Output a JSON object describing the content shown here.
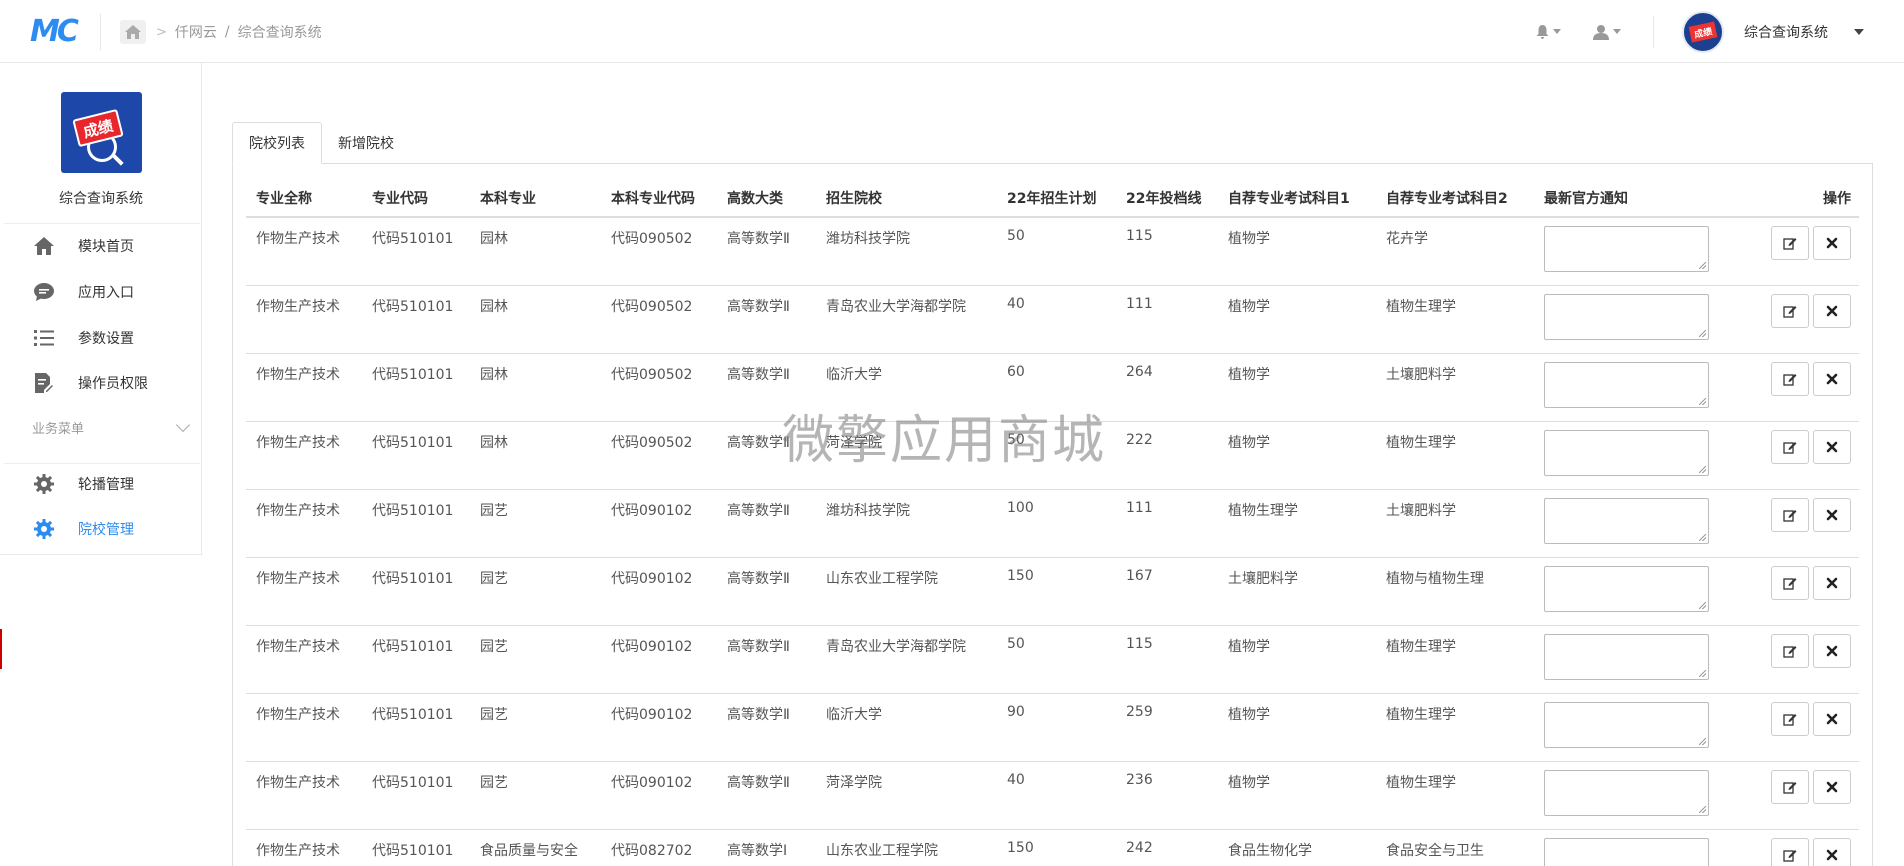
{
  "header": {
    "logo_text": "MC",
    "breadcrumb": [
      "仟网云",
      "综合查询系统"
    ],
    "breadcrumb_separator": "/",
    "user_name": "综合查询系统",
    "avatar_text": "成绩"
  },
  "sidebar": {
    "app_logo_text": "成绩",
    "app_name": "综合查询系统",
    "items": [
      {
        "label": "模块首页",
        "icon": "home-icon"
      },
      {
        "label": "应用入口",
        "icon": "chat-icon"
      },
      {
        "label": "参数设置",
        "icon": "list-icon"
      },
      {
        "label": "操作员权限",
        "icon": "document-edit-icon"
      }
    ],
    "section_title": "业务菜单",
    "section_items": [
      {
        "label": "轮播管理",
        "icon": "gear-icon"
      },
      {
        "label": "院校管理",
        "icon": "gear-icon",
        "active": true
      }
    ],
    "accent_color": "#2d8cf0"
  },
  "tabs": [
    {
      "label": "院校列表",
      "active": true
    },
    {
      "label": "新增院校",
      "active": false
    }
  ],
  "table": {
    "columns": [
      "专业全称",
      "专业代码",
      "本科专业",
      "本科专业代码",
      "高数大类",
      "招生院校",
      "22年招生计划",
      "22年投档线",
      "自荐专业考试科目1",
      "自荐专业考试科目2",
      "最新官方通知",
      "操作"
    ],
    "rows": [
      [
        "作物生产技术",
        "代码510101",
        "园林",
        "代码090502",
        "高等数学Ⅱ",
        "潍坊科技学院",
        "50",
        "115",
        "植物学",
        "花卉学"
      ],
      [
        "作物生产技术",
        "代码510101",
        "园林",
        "代码090502",
        "高等数学Ⅱ",
        "青岛农业大学海都学院",
        "40",
        "111",
        "植物学",
        "植物生理学"
      ],
      [
        "作物生产技术",
        "代码510101",
        "园林",
        "代码090502",
        "高等数学Ⅱ",
        "临沂大学",
        "60",
        "264",
        "植物学",
        "土壤肥料学"
      ],
      [
        "作物生产技术",
        "代码510101",
        "园林",
        "代码090502",
        "高等数学Ⅱ",
        "菏泽学院",
        "50",
        "222",
        "植物学",
        "植物生理学"
      ],
      [
        "作物生产技术",
        "代码510101",
        "园艺",
        "代码090102",
        "高等数学Ⅱ",
        "潍坊科技学院",
        "100",
        "111",
        "植物生理学",
        "土壤肥料学"
      ],
      [
        "作物生产技术",
        "代码510101",
        "园艺",
        "代码090102",
        "高等数学Ⅱ",
        "山东农业工程学院",
        "150",
        "167",
        "土壤肥料学",
        "植物与植物生理"
      ],
      [
        "作物生产技术",
        "代码510101",
        "园艺",
        "代码090102",
        "高等数学Ⅱ",
        "青岛农业大学海都学院",
        "50",
        "115",
        "植物学",
        "植物生理学"
      ],
      [
        "作物生产技术",
        "代码510101",
        "园艺",
        "代码090102",
        "高等数学Ⅱ",
        "临沂大学",
        "90",
        "259",
        "植物学",
        "植物生理学"
      ],
      [
        "作物生产技术",
        "代码510101",
        "园艺",
        "代码090102",
        "高等数学Ⅱ",
        "菏泽学院",
        "40",
        "236",
        "植物学",
        "植物生理学"
      ],
      [
        "作物生产技术",
        "代码510101",
        "食品质量与安全",
        "代码082702",
        "高等数学Ⅰ",
        "山东农业工程学院",
        "150",
        "242",
        "食品生物化学",
        "食品安全与卫生"
      ]
    ]
  },
  "watermark": "微擎应用商城"
}
